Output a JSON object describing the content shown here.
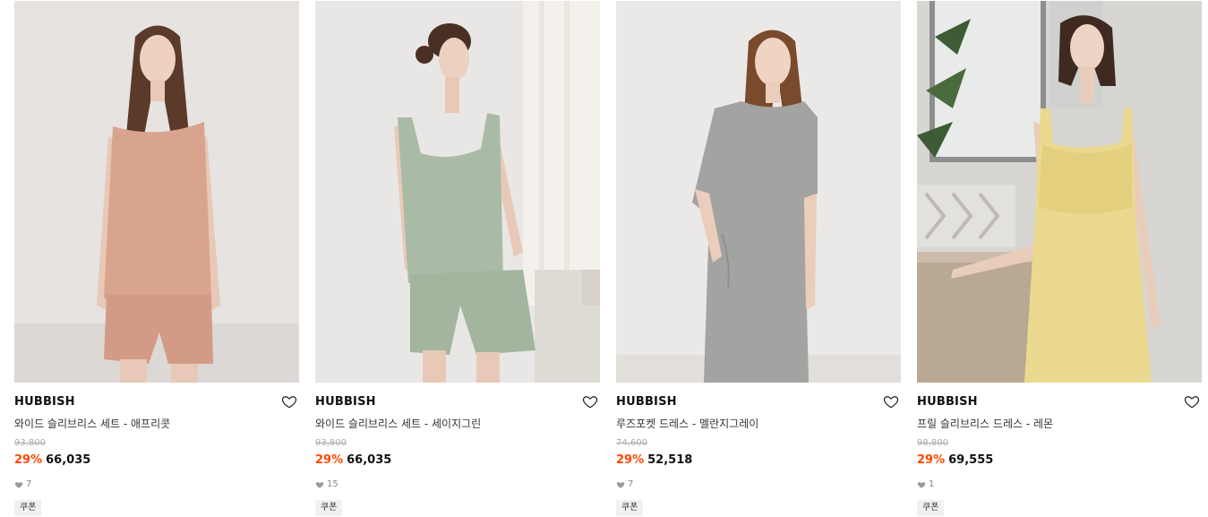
{
  "products": [
    {
      "brand": "HUBBISH",
      "name": "와이드 슬리브리스 세트 - 애프리콧",
      "original_price": "93,800",
      "discount_rate": "29%",
      "sale_price": "66,035",
      "likes": "7",
      "badge": "쿠폰",
      "colors": {
        "bg": "#e6e3e1",
        "garment": "#d9a48e",
        "hair": "#5b3a2a"
      }
    },
    {
      "brand": "HUBBISH",
      "name": "와이드 슬리브리스 세트 - 세이지그린",
      "original_price": "93,800",
      "discount_rate": "29%",
      "sale_price": "66,035",
      "likes": "15",
      "badge": "쿠폰",
      "colors": {
        "bg": "#e9e7e6",
        "garment": "#a9bba6",
        "hair": "#4a3024"
      }
    },
    {
      "brand": "HUBBISH",
      "name": "루즈포켓 드레스 - 멜란지그레이",
      "original_price": "74,600",
      "discount_rate": "29%",
      "sale_price": "52,518",
      "likes": "7",
      "badge": "쿠폰",
      "colors": {
        "bg": "#ebe9e7",
        "garment": "#a3a3a1",
        "hair": "#7a4a2c"
      }
    },
    {
      "brand": "HUBBISH",
      "name": "프릴 슬리브리스 드레스 - 레몬",
      "original_price": "98,800",
      "discount_rate": "29%",
      "sale_price": "69,555",
      "likes": "1",
      "badge": "쿠폰",
      "colors": {
        "bg": "#d8d6d2",
        "garment": "#ead98e",
        "hair": "#3e2a20"
      }
    }
  ],
  "icons": {
    "wish": "heart-outline-icon",
    "likes": "heart-filled-icon"
  },
  "accent_color": "#ff4800"
}
